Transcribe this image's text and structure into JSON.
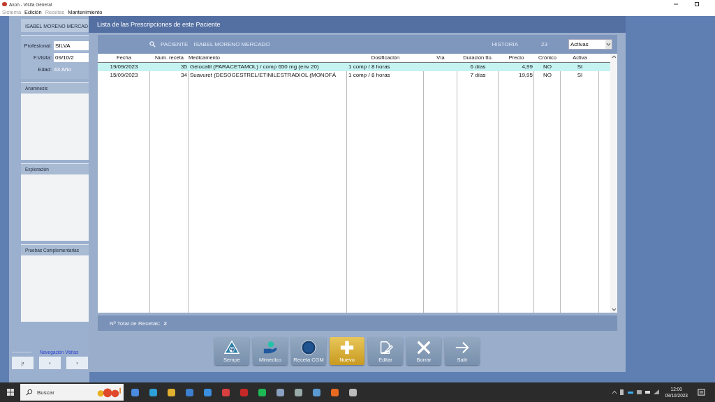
{
  "window": {
    "title": "Axon - Visita General"
  },
  "menu": [
    {
      "label": "Sistema",
      "disabled": true
    },
    {
      "label": "Edición",
      "disabled": false
    },
    {
      "label": "Recetas",
      "disabled": true
    },
    {
      "label": "Mantenimiento",
      "disabled": false
    }
  ],
  "patient_panel": {
    "name": "ISABEL MORENO MERCAD",
    "fields": [
      {
        "label": "Profesional:",
        "value": "SILVA",
        "kind": "input"
      },
      {
        "label": "F.Visita:",
        "value": "09/10/2",
        "kind": "input"
      },
      {
        "label": "Edad:",
        "value": "43 Año",
        "kind": "readonly"
      }
    ],
    "sections": [
      "Anamnesis",
      "Exploración",
      "Pruebas Complementarias"
    ],
    "navigation": {
      "label": "Navegación Visitas",
      "buttons": [
        "|‹",
        "‹",
        "›"
      ]
    }
  },
  "dialog": {
    "title": "Lista de las Prescripciones de este Paciente",
    "patient_label": "PACIENTE",
    "patient_name": "ISABEL MORENO MERCADO",
    "history_label": "HISTORIA",
    "history_value": "23",
    "filter": "Activas",
    "table": {
      "columns": [
        "Fecha",
        "Num. receta",
        "Medicamento",
        "Dosificación",
        "Vía",
        "Duración tto.",
        "Precio",
        "Crónico",
        "Activa"
      ],
      "rows": [
        {
          "selected": true,
          "cells": [
            "19/09/2023",
            "35",
            "Gelocatil (PARACETAMOL) / comp 650 mg (env 20)",
            "1 comp / 8 horas",
            "",
            "6  días",
            "4,99",
            "NO",
            "SI"
          ]
        },
        {
          "selected": false,
          "cells": [
            "15/09/2023",
            "34",
            "Suavuret (DESOGESTREL/ETINILESTRADIOL (MONOFÁ",
            "1 comp / 8 horas",
            "",
            "7  días",
            "19,95",
            "NO",
            "SI"
          ]
        }
      ]
    },
    "total_label": "Nº Total de Recetas:",
    "total_value": "2",
    "buttons": [
      {
        "label": "Sempe",
        "kind": "sempe",
        "highlighted": false
      },
      {
        "label": "Mimedico",
        "kind": "hand",
        "highlighted": false
      },
      {
        "label": "Receta CGM",
        "kind": "cgm",
        "highlighted": false
      },
      {
        "label": "Nuevo",
        "kind": "plus",
        "highlighted": true
      },
      {
        "label": "Editar",
        "kind": "edit",
        "highlighted": false
      },
      {
        "label": "Borrar",
        "kind": "cross",
        "highlighted": false
      },
      {
        "label": "Salir",
        "kind": "arrow",
        "highlighted": false
      }
    ]
  },
  "taskbar": {
    "search_placeholder": "Buscar",
    "time": "12:00",
    "date": "09/10/2023"
  }
}
